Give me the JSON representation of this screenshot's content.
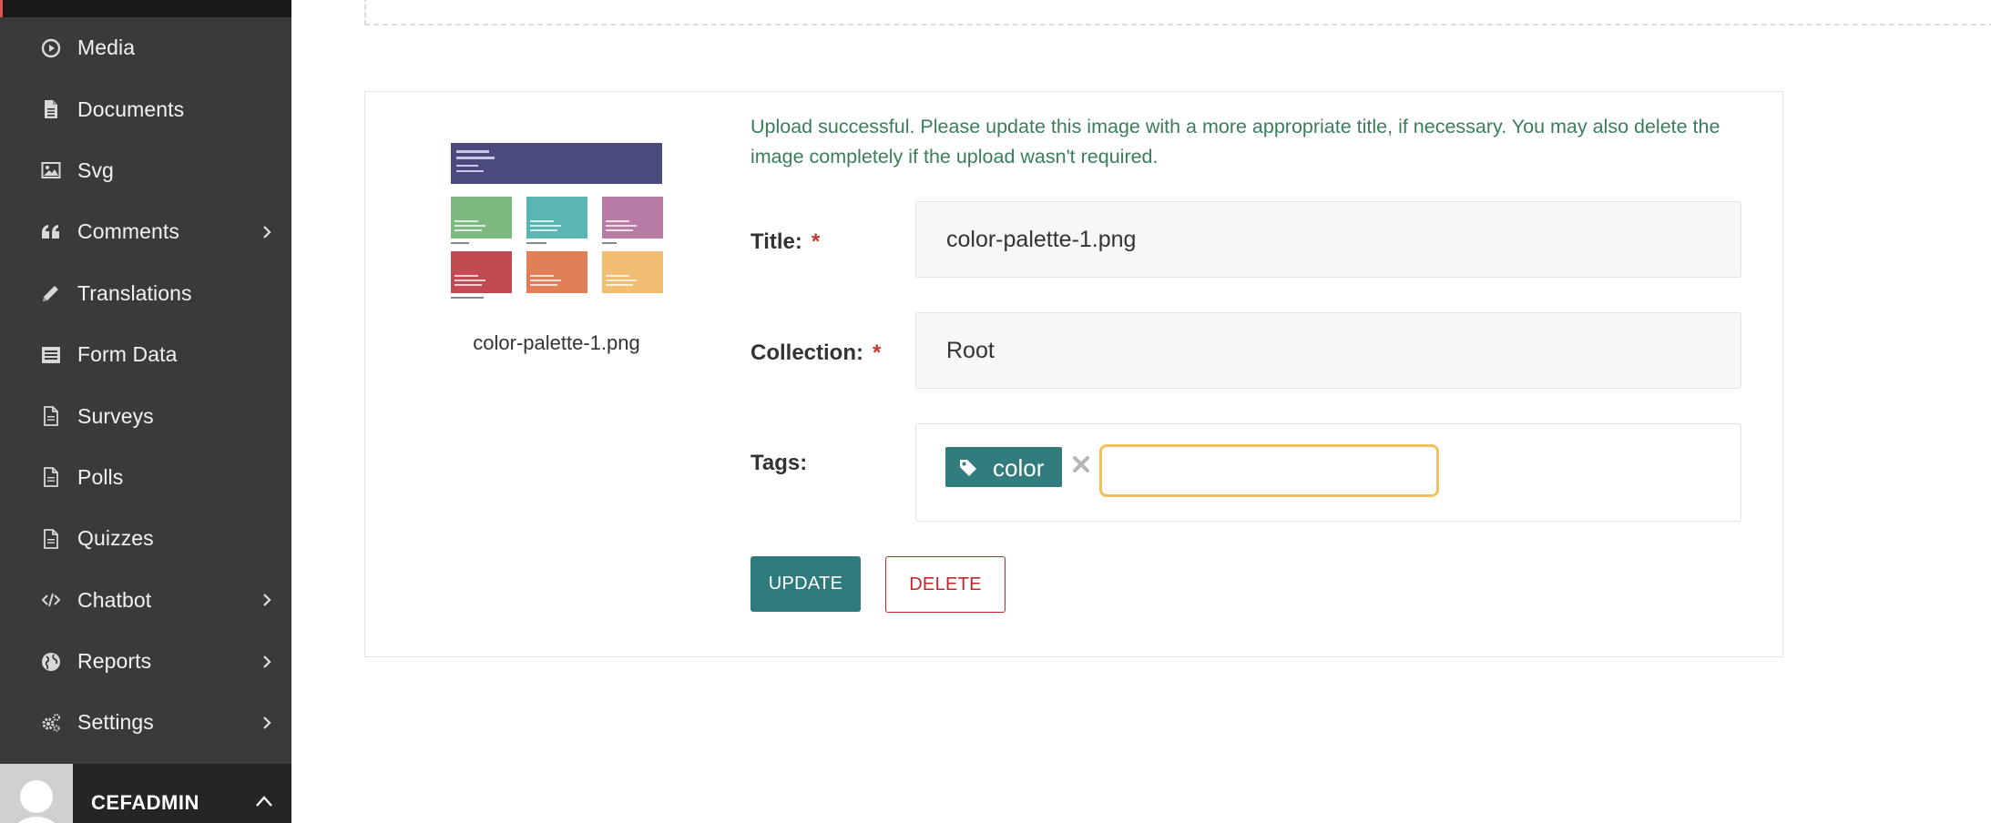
{
  "sidebar": {
    "items": [
      {
        "label": "Media",
        "icon": "play-circle-icon",
        "has_submenu": false
      },
      {
        "label": "Documents",
        "icon": "document-icon",
        "has_submenu": false
      },
      {
        "label": "Svg",
        "icon": "image-icon",
        "has_submenu": false
      },
      {
        "label": "Comments",
        "icon": "quote-icon",
        "has_submenu": true
      },
      {
        "label": "Translations",
        "icon": "pencil-icon",
        "has_submenu": false
      },
      {
        "label": "Form Data",
        "icon": "form-list-icon",
        "has_submenu": false
      },
      {
        "label": "Surveys",
        "icon": "document-outline-icon",
        "has_submenu": false
      },
      {
        "label": "Polls",
        "icon": "document-outline-icon",
        "has_submenu": false
      },
      {
        "label": "Quizzes",
        "icon": "document-outline-icon",
        "has_submenu": false
      },
      {
        "label": "Chatbot",
        "icon": "code-icon",
        "has_submenu": true
      },
      {
        "label": "Reports",
        "icon": "globe-icon",
        "has_submenu": true
      },
      {
        "label": "Settings",
        "icon": "gears-icon",
        "has_submenu": true
      }
    ],
    "user": {
      "name": "CEFADMIN"
    }
  },
  "image_card": {
    "filename": "color-palette-1.png",
    "notice": "Upload successful. Please update this image with a more appropriate title, if necessary. You may also delete the image completely if the upload wasn't required.",
    "title_label": "Title:",
    "title_value": "color-palette-1.png",
    "collection_label": "Collection:",
    "collection_value": "Root",
    "tags_label": "Tags:",
    "tags": [
      "color"
    ],
    "tag_input_value": "",
    "required_marker": "*",
    "update_label": "UPDATE",
    "delete_label": "DELETE"
  },
  "colors": {
    "sidebar_bg": "#3a3a3a",
    "accent_teal": "#2f7a7d",
    "danger_red": "#c0262b",
    "success_green": "#3b7d5a",
    "focus_yellow": "#f0c060",
    "palette_swatches": [
      "#7cb87f",
      "#5ab5b3",
      "#b87ba5",
      "#c24a52",
      "#df7f58",
      "#f0bd72"
    ]
  }
}
